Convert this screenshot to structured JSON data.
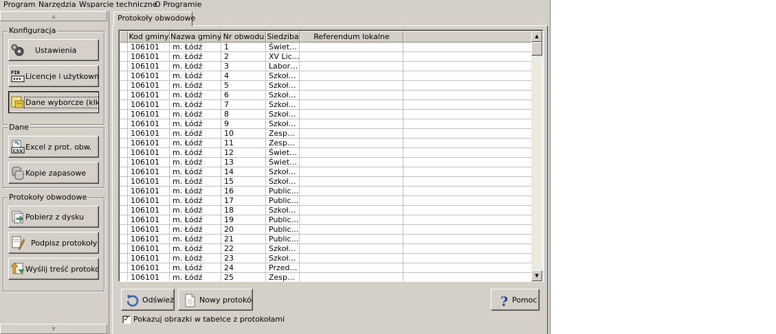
{
  "menu": [
    "Program",
    "Narzędzia",
    "Wsparcie techniczne",
    "O Programie"
  ],
  "left_panel": {
    "groups": [
      {
        "title": "Konfiguracja",
        "buttons": [
          {
            "label": "Ustawienia",
            "icon": "gears-icon"
          },
          {
            "label": "Licencje i użytkownicy",
            "icon": "pin-icon"
          },
          {
            "label": "Dane wyborcze (klk)",
            "icon": "election-data-icon",
            "pressed": true
          }
        ]
      },
      {
        "title": "Dane",
        "buttons": [
          {
            "label": "Excel z prot. obw.",
            "icon": "csv-icon"
          },
          {
            "label": "Kopie zapasowe",
            "icon": "database-icon"
          }
        ]
      },
      {
        "title": "Protokoły obwodowe",
        "buttons": [
          {
            "label": "Pobierz z dysku",
            "icon": "load-from-disk-icon"
          },
          {
            "label": "Podpisz protokoły",
            "icon": "sign-document-icon"
          },
          {
            "label": "Wyślij treść protokołów",
            "icon": "send-icon"
          }
        ]
      }
    ]
  },
  "tab": {
    "label": "Protokoły obwodowe"
  },
  "table": {
    "columns": [
      "Kod gminy",
      "Nazwa gminy",
      "Nr obwodu",
      "Siedziba",
      "Referendum lokalne"
    ],
    "rows": [
      [
        "106101",
        "m. Łódź",
        "1",
        "Świet…",
        ""
      ],
      [
        "106101",
        "m. Łódź",
        "2",
        "XV Lic…",
        ""
      ],
      [
        "106101",
        "m. Łódź",
        "3",
        "Labor…",
        ""
      ],
      [
        "106101",
        "m. Łódź",
        "4",
        "Szkoł…",
        ""
      ],
      [
        "106101",
        "m. Łódź",
        "5",
        "Szkoł…",
        ""
      ],
      [
        "106101",
        "m. Łódź",
        "6",
        "Szkoł…",
        ""
      ],
      [
        "106101",
        "m. Łódź",
        "7",
        "Szkoł…",
        ""
      ],
      [
        "106101",
        "m. Łódź",
        "8",
        "Szkoł…",
        ""
      ],
      [
        "106101",
        "m. Łódź",
        "9",
        "Szkoł…",
        ""
      ],
      [
        "106101",
        "m. Łódź",
        "10",
        "Zesp…",
        ""
      ],
      [
        "106101",
        "m. Łódź",
        "11",
        "Zesp…",
        ""
      ],
      [
        "106101",
        "m. Łódź",
        "12",
        "Świet…",
        ""
      ],
      [
        "106101",
        "m. Łódź",
        "13",
        "Świet…",
        ""
      ],
      [
        "106101",
        "m. Łódź",
        "14",
        "Szkoł…",
        ""
      ],
      [
        "106101",
        "m. Łódź",
        "15",
        "Szkoł…",
        ""
      ],
      [
        "106101",
        "m. Łódź",
        "16",
        "Public…",
        ""
      ],
      [
        "106101",
        "m. Łódź",
        "17",
        "Public…",
        ""
      ],
      [
        "106101",
        "m. Łódź",
        "18",
        "Szkoł…",
        ""
      ],
      [
        "106101",
        "m. Łódź",
        "19",
        "Public…",
        ""
      ],
      [
        "106101",
        "m. Łódź",
        "20",
        "Public…",
        ""
      ],
      [
        "106101",
        "m. Łódź",
        "21",
        "Public…",
        ""
      ],
      [
        "106101",
        "m. Łódź",
        "22",
        "Szkoł…",
        ""
      ],
      [
        "106101",
        "m. Łódź",
        "23",
        "Szkoł…",
        ""
      ],
      [
        "106101",
        "m. Łódź",
        "24",
        "Przed…",
        ""
      ],
      [
        "106101",
        "m. Łódź",
        "25",
        "Zesp…",
        ""
      ]
    ]
  },
  "bottom": {
    "refresh_label": "Odśwież",
    "new_protocol_label": "Nowy protokół",
    "help_label": "Pomoc",
    "show_images_label": "Pokazuj obrazki w tabelce z protokołami",
    "show_images_checked": true
  }
}
